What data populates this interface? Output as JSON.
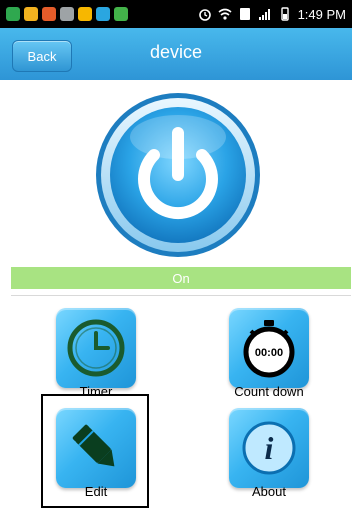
{
  "status_bar": {
    "time": "1:49 PM"
  },
  "header": {
    "back_label": "Back",
    "title": "device"
  },
  "power": {
    "state_label": "On"
  },
  "functions": [
    {
      "label": "Timer"
    },
    {
      "label": "Count down",
      "icon_text": "00:00"
    },
    {
      "label": "Edit"
    },
    {
      "label": "About"
    }
  ],
  "colors": {
    "header": "#3aa7e2",
    "on_bar": "#a8e382"
  }
}
